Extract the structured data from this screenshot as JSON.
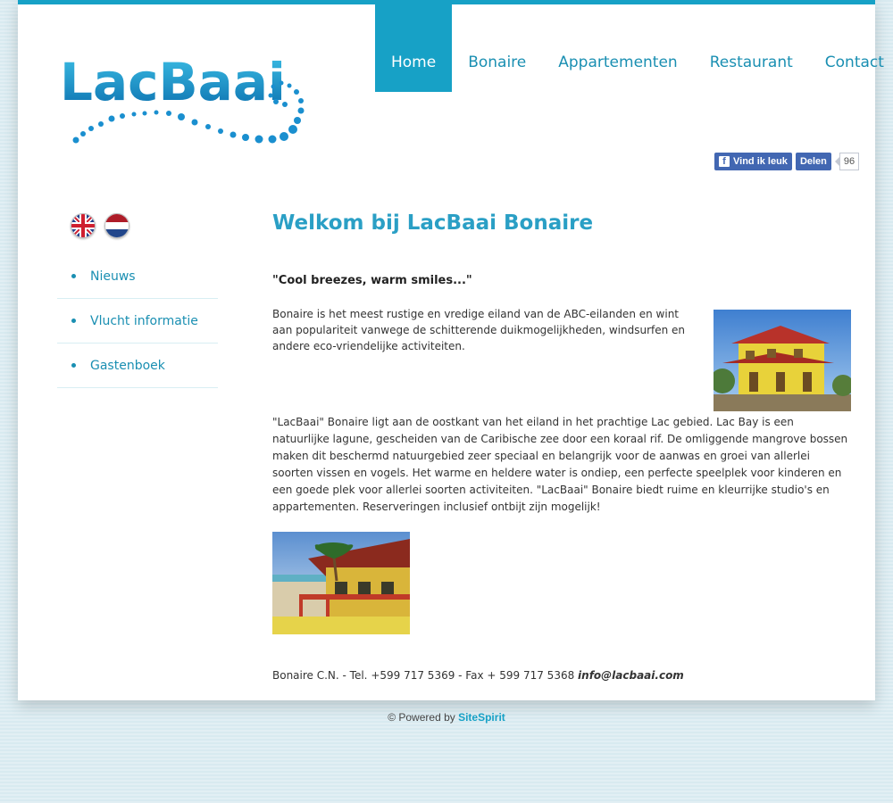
{
  "brand": {
    "logo_text": "LacBaai"
  },
  "nav": [
    {
      "label": "Home",
      "active": true
    },
    {
      "label": "Bonaire"
    },
    {
      "label": "Appartementen"
    },
    {
      "label": "Restaurant"
    },
    {
      "label": "Contact"
    }
  ],
  "social": {
    "like_label": "Vind ik leuk",
    "share_label": "Delen",
    "count": "96"
  },
  "languages": [
    "English",
    "Nederlands"
  ],
  "sidebar": {
    "items": [
      {
        "label": "Nieuws"
      },
      {
        "label": "Vlucht informatie"
      },
      {
        "label": "Gastenboek"
      }
    ]
  },
  "main": {
    "title": "Welkom bij LacBaai Bonaire",
    "slogan": "\"Cool breezes, warm smiles...\"",
    "paragraph1": "Bonaire is het meest rustige en vredige eiland van de ABC-eilanden en wint aan populariteit vanwege de schitterende duikmogelijkheden, windsurfen en andere eco-vriendelijke activiteiten.",
    "paragraph2": "\"LacBaai\" Bonaire ligt aan de oostkant van het eiland in het prachtige Lac gebied. Lac Bay is een natuurlijke lagune, gescheiden van de Caribische zee door een koraal rif. De omliggende mangrove bossen maken dit beschermd natuurgebied zeer speciaal en belangrijk voor de aanwas en groei van allerlei soorten vissen en vogels. Het warme en heldere water is ondiep, een perfecte speelplek voor kinderen en een goede plek voor allerlei soorten activiteiten. \"LacBaai\" Bonaire biedt ruime en kleurrijke studio's en appartementen. Reserveringen inclusief ontbijt zijn mogelijk!",
    "contact_text": "Bonaire C.N. - Tel. +599 717 5369 - Fax + 599 717 5368 ",
    "contact_email": "info@lacbaai.com"
  },
  "footer": {
    "prefix": "© Powered by ",
    "brand": "SiteSpirit"
  },
  "colors": {
    "accent": "#17a1c6",
    "text": "#333333",
    "background": "#d8eaf0"
  }
}
